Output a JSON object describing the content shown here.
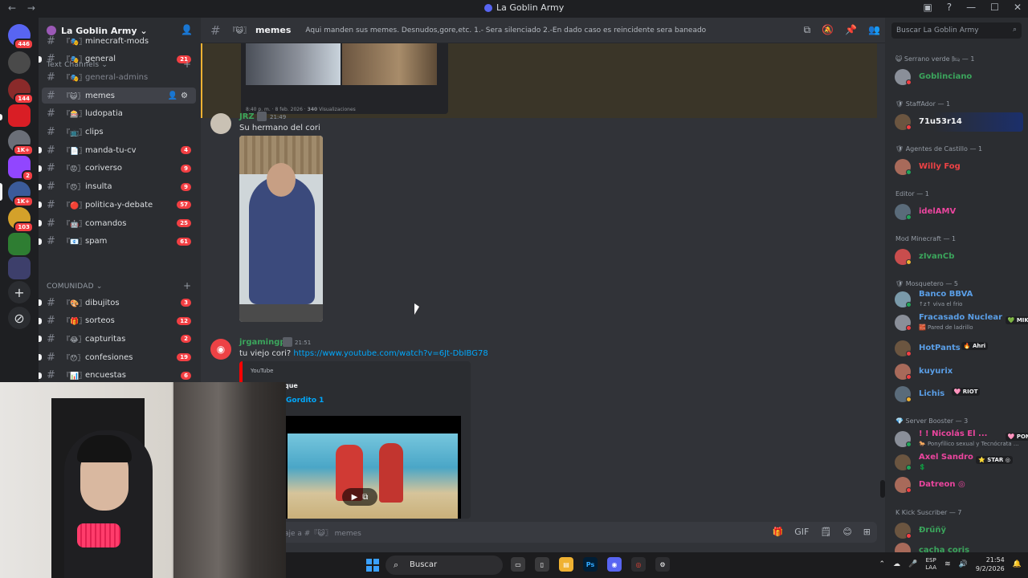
{
  "window": {
    "title": "La Goblin Army",
    "nav_back": "←",
    "nav_forward": "→",
    "title_icons": [
      "▣",
      "?",
      "—",
      "☐",
      "✕"
    ]
  },
  "rail": {
    "badges": [
      "446",
      "144",
      "1K+",
      "2",
      "1K+",
      "103"
    ],
    "add_label": "+",
    "explore_label": "⊘"
  },
  "guild": {
    "name": "La Goblin Army ⌄",
    "invite_icon": "👤"
  },
  "categories": {
    "text": "Text Channels ⌄",
    "community": "COMUNIDAD ⌄"
  },
  "channels_text": [
    {
      "prefix": "『🎭〗",
      "name": "minecraft-mods",
      "count": ""
    },
    {
      "prefix": "『🎭〗",
      "name": "general",
      "count": "21"
    },
    {
      "prefix": "『🎭〗",
      "name": "general-admins",
      "count": ""
    },
    {
      "prefix": "『😺〗",
      "name": "memes",
      "count": ""
    },
    {
      "prefix": "『🎰〗",
      "name": "ludopatia",
      "count": ""
    },
    {
      "prefix": "『📺〗",
      "name": "clips",
      "count": ""
    },
    {
      "prefix": "『📄〗",
      "name": "manda-tu-cv",
      "count": "4"
    },
    {
      "prefix": "『😡〗",
      "name": "coriverso",
      "count": "9"
    },
    {
      "prefix": "『😠〗",
      "name": "insulta",
      "count": "9"
    },
    {
      "prefix": "『🔴〗",
      "name": "politica-y-debate",
      "count": "57"
    },
    {
      "prefix": "『🤖〗",
      "name": "comandos",
      "count": "25"
    },
    {
      "prefix": "『📧〗",
      "name": "spam",
      "count": "61"
    }
  ],
  "channels_community": [
    {
      "prefix": "『🎨〗",
      "name": "dibujitos",
      "count": "3"
    },
    {
      "prefix": "『🎁〗",
      "name": "sorteos",
      "count": "12"
    },
    {
      "prefix": "『😂〗",
      "name": "capturitas",
      "count": "2"
    },
    {
      "prefix": "『😯〗",
      "name": "confesiones",
      "count": "19"
    },
    {
      "prefix": "『📊〗",
      "name": "encuestas",
      "count": "6"
    }
  ],
  "chat": {
    "header_prefix": "『😺〗",
    "channel": "memes",
    "topic": "Aqui manden sus memes. Desnudos,gore,etc. 1.- Sera silenciado 2.-En dado caso es reincidente sera baneado",
    "header_icons": [
      "⧉",
      "🔕",
      "📌",
      "👥"
    ],
    "prev_caption_time": "8:40 p. m. · 8 feb. 2026 ·",
    "prev_caption_views": "340",
    "prev_caption_suffix": "Visualizaciones",
    "messages": [
      {
        "user": "JRZ",
        "time": "21:49",
        "text": "Su hermano del cori"
      },
      {
        "user": "jrgamingpc",
        "time": "21:51",
        "text": "tu viejo cori?",
        "link": "https://www.youtube.com/watch?v=6Jt-DbIBG78"
      }
    ],
    "embed": {
      "provider": "YouTube",
      "title_partial": "que",
      "video_title": "Gordito 1"
    },
    "composer_placeholder": "aje a #『😺〗 memes",
    "composer_icons": [
      "🎁",
      "GIF",
      "🗒",
      "😊",
      "⊞"
    ]
  },
  "members": {
    "search_placeholder": "Buscar La Goblin Army",
    "groups": [
      {
        "title": "😺 Serrano verde 🛏 — 1",
        "members": [
          {
            "name": "Goblinciano",
            "color": "#3ba55c",
            "status": "",
            "tag": "",
            "dot": "#f23f43"
          }
        ]
      },
      {
        "title": "🛡 StaffAdor — 1",
        "members": [
          {
            "name": "71u53r14",
            "color": "#f2f3f5",
            "status": "",
            "tag": "",
            "dot": "#f23f43"
          }
        ]
      },
      {
        "title": "🛡 Agentes de Castillo — 1",
        "members": [
          {
            "name": "Willy Fog",
            "color": "#ed4245",
            "status": "",
            "tag": "",
            "dot": "#23a55a"
          }
        ]
      },
      {
        "title": "Editor — 1",
        "members": [
          {
            "name": "idelAMV",
            "color": "#eb459e",
            "status": "",
            "tag": "",
            "dot": "#23a55a"
          }
        ]
      },
      {
        "title": "Mod Minecraft — 1",
        "members": [
          {
            "name": "zIvanCb",
            "color": "#3ba55c",
            "status": "",
            "tag": "",
            "dot": "#f0b232"
          }
        ]
      },
      {
        "title": "🛡 Mosquetero — 5",
        "members": [
          {
            "name": "Banco BBVA",
            "color": "#5a9ee6",
            "status": "↑z↑ viva el frio",
            "tag": "",
            "dot": "#23a55a"
          },
          {
            "name": "Fracasado Nuclear",
            "color": "#5a9ee6",
            "status": "🧱 Pared de ladrillo",
            "tag": "💚 MIKU",
            "dot": "#f23f43"
          },
          {
            "name": "HotPants",
            "color": "#5a9ee6",
            "status": "",
            "tag": "🔥 Ahri",
            "dot": "#f23f43"
          },
          {
            "name": "kuyurix",
            "color": "#5a9ee6",
            "status": "",
            "tag": "",
            "dot": "#f23f43"
          },
          {
            "name": "Lichis",
            "color": "#5a9ee6",
            "status": "",
            "tag": "🩷 RIOT",
            "dot": "#f0b232"
          }
        ]
      },
      {
        "title": "💎 Server Booster — 3",
        "members": [
          {
            "name": "! ! Nicolás El ...",
            "color": "#eb459e",
            "status": "🐎 Ponyfílico sexual y Tecnócrata ...",
            "tag": "🩷 PONY ◎",
            "dot": "#23a55a"
          },
          {
            "name": "Axel Sandro",
            "color": "#eb459e",
            "status": "💲",
            "tag": "⭐ STAR ◎",
            "dot": "#23a55a"
          },
          {
            "name": "Datreon ◎",
            "color": "#eb459e",
            "status": "",
            "tag": "",
            "dot": "#f23f43"
          }
        ]
      },
      {
        "title": "K Kick Suscriber — 7",
        "members": [
          {
            "name": "Ðrűñÿ",
            "color": "#3ba55c",
            "status": "",
            "tag": "",
            "dot": "#f23f43"
          },
          {
            "name": "cacha coris",
            "color": "#3ba55c",
            "status": "",
            "tag": "",
            "dot": "#f23f43"
          }
        ]
      }
    ]
  },
  "taskbar": {
    "search_label": "Buscar",
    "lang_top": "ESP",
    "lang_bottom": "LAA",
    "time": "21:54",
    "date": "9/2/2026",
    "tray_chevron": "⌃",
    "discord_badge": "99+"
  },
  "colors": {
    "accent": "#5865f2",
    "danger": "#f23f43",
    "link": "#00a8fc"
  }
}
